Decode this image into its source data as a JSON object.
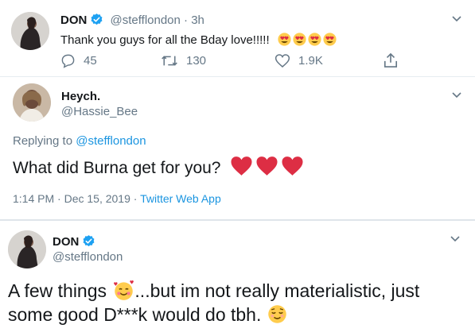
{
  "tweet1": {
    "display_name": "DON",
    "handle": "@stefflondon",
    "time": "· 3h",
    "text": "Thank you guys for all the Bday love!!!!!",
    "actions": {
      "reply_count": "45",
      "retweet_count": "130",
      "like_count": "1.9K"
    }
  },
  "tweet2": {
    "display_name": "Heych.",
    "handle": "@Hassie_Bee",
    "replying_prefix": "Replying to",
    "replying_handle": "@stefflondon",
    "text": "What did Burna get for you?",
    "timestamp": "1:14 PM · Dec 15, 2019 ·",
    "source": "Twitter Web App"
  },
  "tweet3": {
    "display_name": "DON",
    "handle": "@stefflondon",
    "text_part1": "A few things",
    "text_part2": "...but im not really materialistic, just",
    "text_line2": "some good D***k would do tbh."
  },
  "icons": {
    "verified": "verified-badge-icon",
    "chevron": "chevron-down-icon",
    "reply": "reply-icon",
    "retweet": "retweet-icon",
    "like": "heart-outline-icon",
    "share": "share-icon"
  },
  "colors": {
    "link": "#1b95e0",
    "muted": "#657786",
    "heart": "#dd2e44",
    "emoji": "#ffcc4d"
  }
}
